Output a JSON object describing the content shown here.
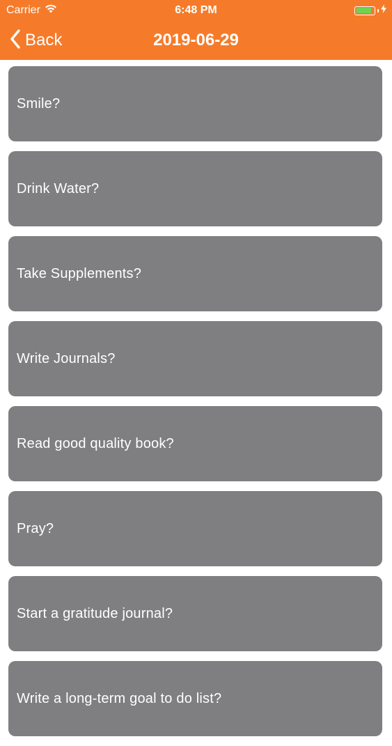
{
  "status_bar": {
    "carrier": "Carrier",
    "time": "6:48 PM",
    "wifi_icon": "wifi-icon",
    "battery_icon": "battery-icon",
    "charging_icon": "bolt-icon",
    "battery_level": 0.85
  },
  "nav": {
    "back_label": "Back",
    "back_icon": "chevron-left-icon",
    "title": "2019-06-29"
  },
  "colors": {
    "accent": "#f57b2a",
    "card": "#7f7e80",
    "battery_fill": "#6fd250"
  },
  "habits": [
    {
      "label": "Smile?"
    },
    {
      "label": "Drink Water?"
    },
    {
      "label": "Take Supplements?"
    },
    {
      "label": "Write Journals?"
    },
    {
      "label": "Read good quality book?"
    },
    {
      "label": "Pray?"
    },
    {
      "label": "Start a gratitude journal?"
    },
    {
      "label": "Write a long-term goal to do list?"
    }
  ]
}
